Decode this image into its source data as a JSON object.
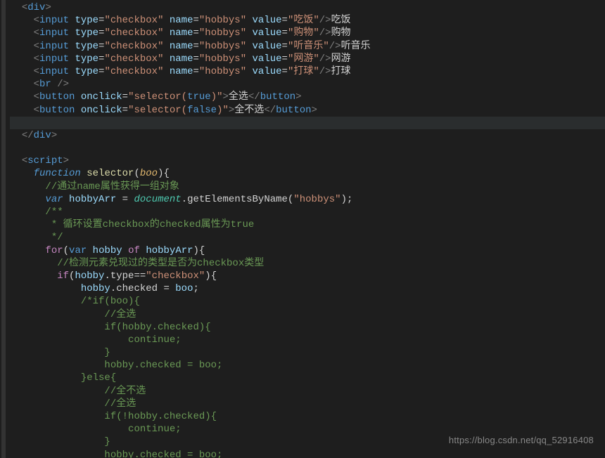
{
  "watermark": "https://blog.csdn.net/qq_52916408",
  "tokens": {
    "div": "div",
    "input": "input",
    "br": "br",
    "button": "button",
    "script": "script",
    "type": "type",
    "name": "name",
    "value": "value",
    "onclick": "onclick",
    "checkbox": "\"checkbox\"",
    "hobbys": "\"hobbys\"",
    "hobbys2": "\"hobbys\"",
    "v_eat": "\"吃饭\"",
    "v_shop": "\"购物\"",
    "v_music": "\"听音乐\"",
    "v_game": "\"网游\"",
    "v_ball": "\"打球\"",
    "t_eat": "吃饭",
    "t_shop": "购物",
    "t_music": "听音乐",
    "t_game": "网游",
    "t_ball": "打球",
    "sel_true": "\"selector(",
    "sel_close": ")\"",
    "true": "true",
    "false": "false",
    "all": "全选",
    "none": "全不选",
    "function": "function",
    "selector": "selector",
    "boo": "boo",
    "c1": "//通过name属性获得一组对象",
    "var": "var",
    "hobbyArr": "hobbyArr",
    "document": "document",
    "getByName": ".getElementsByName(",
    "c2a": "/**",
    "c2b": " * 循环设置checkbox的checked属性为true",
    "c2c": " */",
    "for": "for",
    "hobby": "hobby",
    "of": "of",
    "c3": "//检测元素兑现过的类型是否为checkbox类型",
    "if": "if",
    "typeAttr": ".type",
    "eqeq": "==",
    "checked": ".checked",
    "eq": " = ",
    "semi": ";",
    "cm_ifboo": "/*if(boo){",
    "cm_all": "    //全选",
    "cm_ifchecked": "    if(hobby.checked){",
    "cm_continue": "        continue;",
    "cm_brace": "    }",
    "cm_assign": "    hobby.checked = boo;",
    "cm_else": "}else{",
    "cm_none": "    //全不选",
    "cm_all2": "    //全选",
    "cm_ifnot": "    if(!hobby.checked){"
  }
}
